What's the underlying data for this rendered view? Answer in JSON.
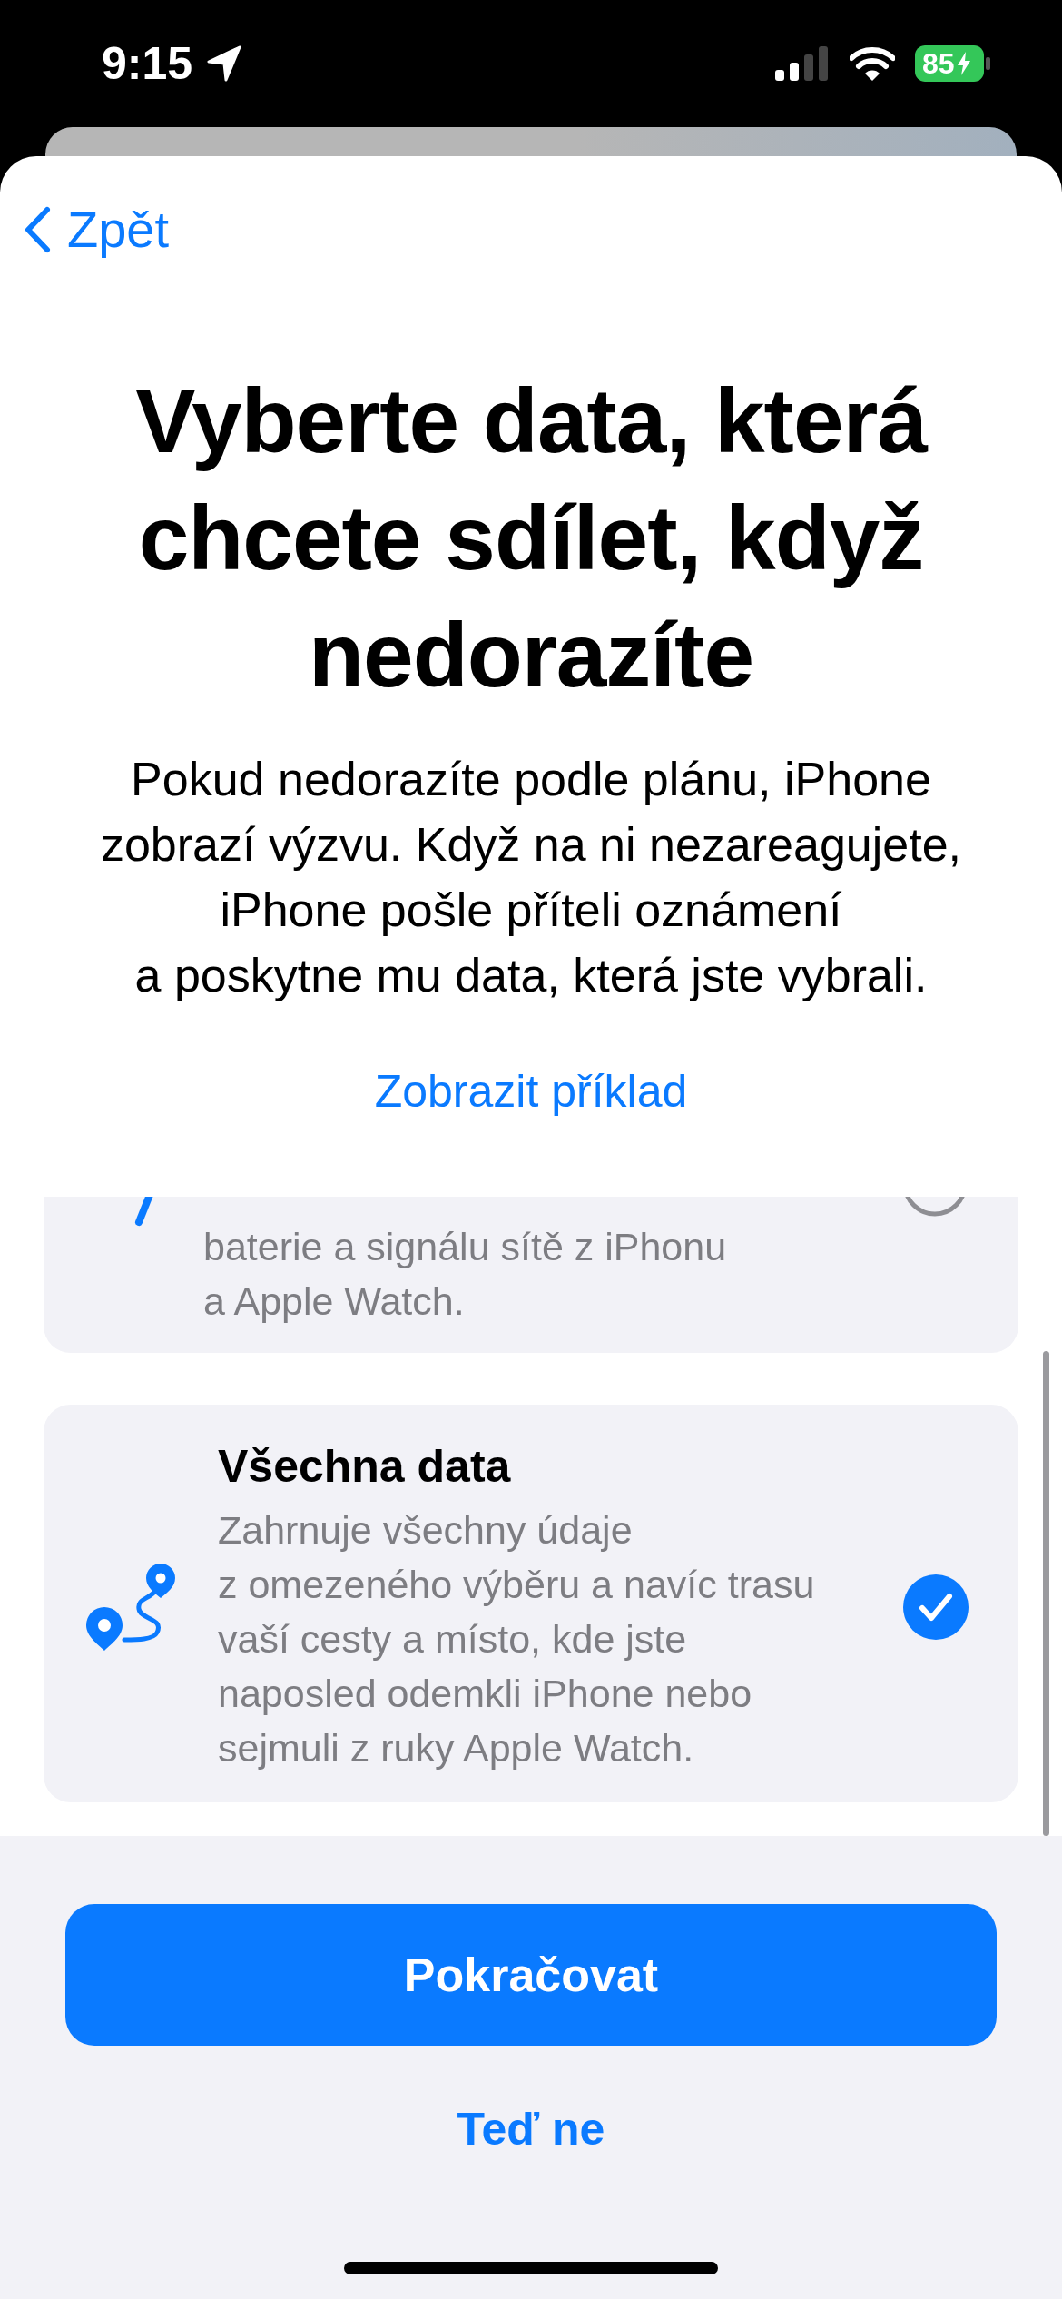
{
  "status_bar": {
    "time": "9:15",
    "battery": "85"
  },
  "back": {
    "label": "Zpět"
  },
  "title": "Vyberte data, která\nchcete sdílet, když\nnedorazíte",
  "description": "Pokud nedorazíte podle plánu, iPhone\nzobrazí výzvu. Když na ni nezareagujete,\niPhone pošle příteli oznámení\na poskytne mu data, která jste vybrali.",
  "link": "Zobrazit příklad",
  "options": [
    {
      "kind": "cut",
      "description": "baterie a signálu sítě z iPhonu\na Apple Watch.",
      "selected": false
    },
    {
      "kind": "full",
      "title": "Všechna data",
      "description": "Zahrnuje všechny údaje\nz omezeného výběru a navíc trasu\nvaší cesty a místo, kde jste\nnaposled odemkli iPhone nebo\nsejmuli z ruky Apple Watch.",
      "selected": true
    }
  ],
  "primary_button": "Pokračovat",
  "secondary_button": "Teď ne"
}
